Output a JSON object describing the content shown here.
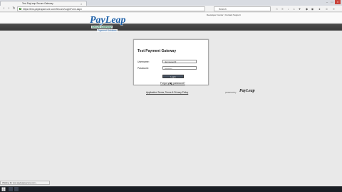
{
  "browser": {
    "tab_title": "Test PayLeap Secure Gateway",
    "url": "https://test.payleapsecure.com/Secure/LoginForm.aspx",
    "search_placeholder": "Search"
  },
  "header": {
    "links": "Developer Center | Contact Support",
    "logo_main": "PayLeap",
    "logo_sub": "Secure Gateway",
    "logo_sub2": "Payment Solutions"
  },
  "login": {
    "title": "Test Payment Gateway",
    "username_label": "Username:",
    "username_value": "demouser@",
    "password_label": "Password:",
    "password_value": "••••••••••",
    "button_label": "Login",
    "forgot_link": "Forgot your password?"
  },
  "footer": {
    "link": "Application Terms, Terms & Privacy Policy",
    "powered_by": "powered by",
    "powered_logo": "PayLeap"
  },
  "status_bar": "Waiting for test.payleapsecure.com...",
  "colors": {
    "logo_blue": "#1c5fa7",
    "header_dark": "#3a3a3a",
    "button": "#4a5666"
  }
}
